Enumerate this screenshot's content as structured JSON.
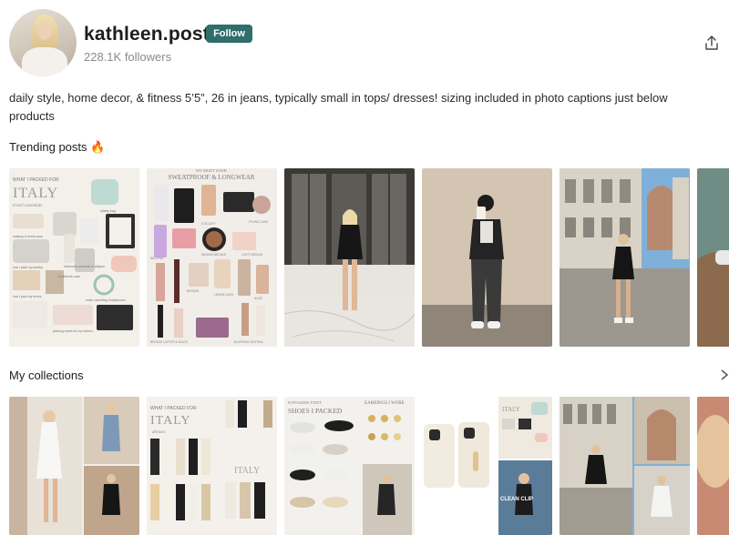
{
  "profile": {
    "username": "kathleen.post",
    "follow_label": "Follow",
    "followers": "228.1K followers",
    "bio": "daily style, home decor, & fitness 5’5”, 26 in jeans, typically small in tops/ dresses! sizing included in photo captions just below products"
  },
  "sections": {
    "trending_title": "Trending posts 🔥",
    "collections_title": "My collections"
  },
  "trending_posts": [
    {
      "kind": "flatlay",
      "title_small": "WHAT I PACKED FOR",
      "title_big": "ITALY",
      "subtitle": "travel essentials",
      "labels": [
        "makeup & brush case",
        "toiletry bag",
        "electronic converter & adaptor",
        "how i pack my jewelry",
        "toothbrush case",
        "how i pack my shoes",
        "packing cubes for my clothes",
        "noise cancelling headphones"
      ]
    },
    {
      "kind": "makeup",
      "title_small": "MY MUST HAVE",
      "title_big": "SWEATPROOF & LONGWEAR",
      "labels": [
        "E.SCULPT",
        "NEUTRAL",
        "POUND CAKE",
        "MEDIUM BRONZE",
        "LIGHT MEDIUM",
        "BRONZE",
        "LEMON CASH",
        "BLURRING NEUTRAL",
        "BRONZE LUSTER & BLACK",
        "NUDE"
      ]
    },
    {
      "kind": "photo",
      "scene": "lobby"
    },
    {
      "kind": "photo",
      "scene": "mirror"
    },
    {
      "kind": "photo",
      "scene": "duomo"
    },
    {
      "kind": "photo",
      "scene": "partial"
    }
  ],
  "collections": [
    {
      "kind": "photo",
      "scene": "stairs"
    },
    {
      "kind": "flatlay",
      "title_small": "WHAT I PACKED FOR",
      "title_big": "ITALY",
      "subtitle": "dresses"
    },
    {
      "kind": "shoes",
      "title_small": "KATHLEEN POST",
      "title_big": "SHOES I PACKED",
      "title_right": "EARRINGS I WORE"
    },
    {
      "kind": "phone",
      "title_big": "ITALY",
      "caption": "CLEAN CLIP"
    },
    {
      "kind": "photo",
      "scene": "duomo2"
    },
    {
      "kind": "photo",
      "scene": "partial2"
    }
  ],
  "colors": {
    "follow_bg": "#2f6e6a",
    "follow_text": "#ffffff",
    "followers_text": "#8a8a8a"
  },
  "icons": {
    "share": "share-icon",
    "chevron": "chevron-right-icon",
    "fire": "fire-emoji"
  }
}
